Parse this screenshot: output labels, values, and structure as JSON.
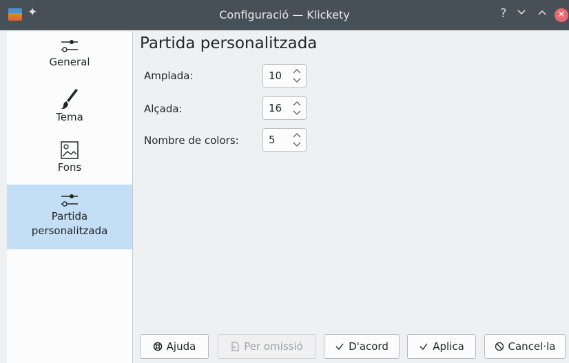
{
  "window": {
    "title": "Configuració — Klickety"
  },
  "titlebar": {
    "help": "?",
    "minimize": "⌄",
    "maximize": "⌃",
    "close": "✕"
  },
  "sidebar": {
    "items": [
      {
        "label": "General",
        "icon": "sliders-icon"
      },
      {
        "label": "Tema",
        "icon": "brush-icon"
      },
      {
        "label": "Fons",
        "icon": "image-icon"
      },
      {
        "label_line1": "Partida",
        "label_line2": "personalitzada",
        "icon": "sliders-icon",
        "selected": true
      }
    ]
  },
  "main": {
    "title": "Partida personalitzada",
    "fields": [
      {
        "label": "Amplada:",
        "value": "10"
      },
      {
        "label": "Alçada:",
        "value": "16"
      },
      {
        "label": "Nombre de colors:",
        "value": "5"
      }
    ]
  },
  "buttons": {
    "help": "Ajuda",
    "defaults": "Per omissió",
    "ok": "D'acord",
    "apply": "Aplica",
    "cancel": "Cancel·la"
  },
  "colors": {
    "titlebar": "#475057",
    "selection": "#c4def5",
    "close": "#e96a6f"
  }
}
